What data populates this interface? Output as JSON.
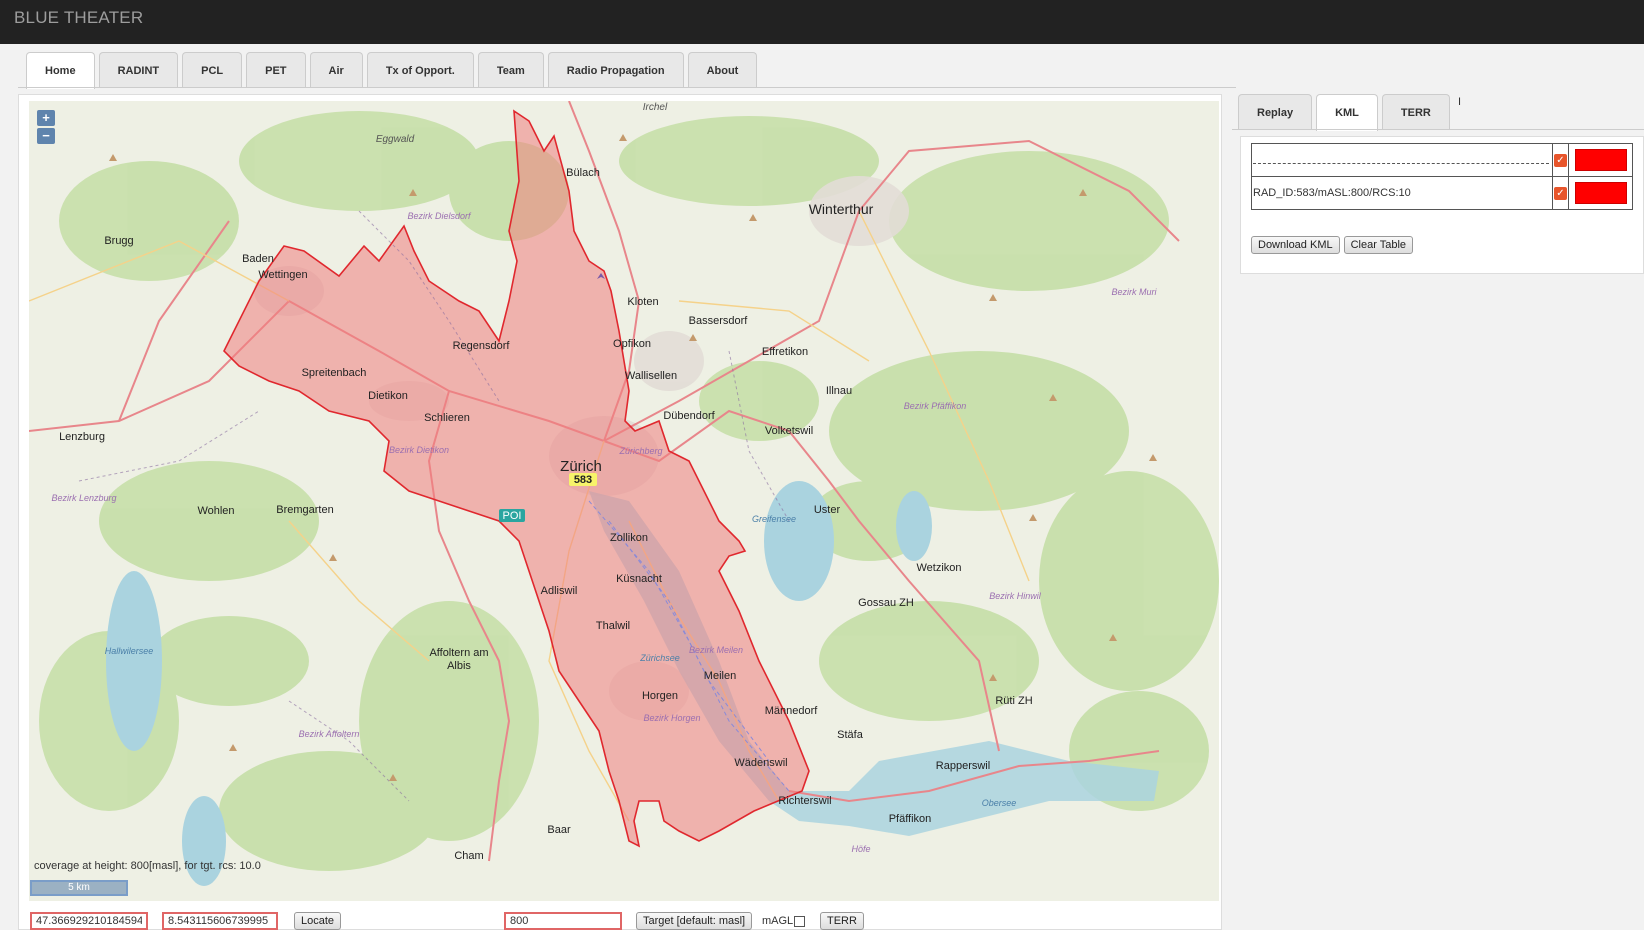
{
  "header": {
    "title": "BLUE THEATER"
  },
  "tabs": [
    "Home",
    "RADINT",
    "PCL",
    "PET",
    "Air",
    "Tx of Opport.",
    "Team",
    "Radio Propagation",
    "About"
  ],
  "map": {
    "zoom_in": "+",
    "zoom_out": "−",
    "radar_id": "583",
    "poi_label": "POI",
    "coverage_text": "coverage at height: 800[masl], for tgt. rcs: 10.0",
    "scale_text": "5 km",
    "places": [
      {
        "name": "Zürich",
        "big": true
      },
      {
        "name": "Winterthur",
        "big": true
      },
      {
        "name": "Bülach"
      },
      {
        "name": "Kloten"
      },
      {
        "name": "Bassersdorf"
      },
      {
        "name": "Opfikon"
      },
      {
        "name": "Regensdorf"
      },
      {
        "name": "Wallisellen"
      },
      {
        "name": "Dübendorf"
      },
      {
        "name": "Effretikon"
      },
      {
        "name": "Illnau"
      },
      {
        "name": "Volketswil"
      },
      {
        "name": "Uster"
      },
      {
        "name": "Wetzikon"
      },
      {
        "name": "Gossau ZH"
      },
      {
        "name": "Rüti ZH"
      },
      {
        "name": "Zollikon"
      },
      {
        "name": "Küsnacht"
      },
      {
        "name": "Thalwil"
      },
      {
        "name": "Adliswil"
      },
      {
        "name": "Horgen"
      },
      {
        "name": "Meilen"
      },
      {
        "name": "Männedorf"
      },
      {
        "name": "Stäfa"
      },
      {
        "name": "Wädenswil"
      },
      {
        "name": "Richterswil"
      },
      {
        "name": "Rapperswil"
      },
      {
        "name": "Pfäffikon"
      },
      {
        "name": "Baar"
      },
      {
        "name": "Cham"
      },
      {
        "name": "Affoltern am"
      },
      {
        "name": "Albis"
      },
      {
        "name": "Schlieren"
      },
      {
        "name": "Dietikon"
      },
      {
        "name": "Spreitenbach"
      },
      {
        "name": "Wettingen"
      },
      {
        "name": "Baden"
      },
      {
        "name": "Brugg"
      },
      {
        "name": "Lenzburg"
      },
      {
        "name": "Wohlen"
      },
      {
        "name": "Bremgarten"
      },
      {
        "name": "Eggwald"
      },
      {
        "name": "Irchel"
      }
    ],
    "districts": [
      "Bezirk Dielsdorf",
      "Bezirk Dietikon",
      "Bezirk Lenzburg",
      "Bezirk Affoltern",
      "Bezirk Meilen",
      "Bezirk Horgen",
      "Bezirk Pfäffikon",
      "Bezirk Hinwil",
      "Bezirk Muri",
      "Greifensee",
      "Zürichsee",
      "Hallwilersee",
      "Obersee",
      "Zürichberg",
      "Höfe"
    ]
  },
  "location": {
    "lat": "47.366929210184594",
    "lon": "8.543115606739995",
    "locate_button": "Locate",
    "height": "800",
    "target_button": "Target [default: masl]",
    "magl_label": "mAGL",
    "terr_button": "TERR"
  },
  "right_tabs": [
    "Replay",
    "KML",
    "TERR"
  ],
  "right_cursor": "I",
  "kml_table": {
    "rows": [
      {
        "label": "",
        "checked": true,
        "color": "#ff0000"
      },
      {
        "label": "RAD_ID:583/mASL:800/RCS:10",
        "checked": true,
        "color": "#ff0000"
      }
    ],
    "download_button": "Download KML",
    "clear_button": "Clear Table"
  },
  "colors": {
    "coverage_fill": "#f08080",
    "coverage_stroke": "#e0282e",
    "topbar": "#222222"
  }
}
